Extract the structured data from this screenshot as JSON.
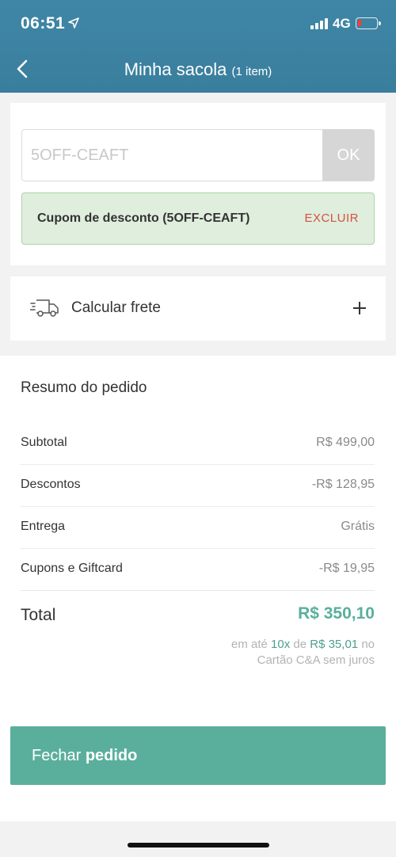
{
  "status_bar": {
    "time": "06:51",
    "network": "4G"
  },
  "nav": {
    "title": "Minha sacola",
    "item_count": "(1 item)"
  },
  "coupon": {
    "input_value": "5OFF-CEAFT",
    "ok_label": "OK",
    "applied_text": "Cupom de desconto (5OFF-CEAFT)",
    "remove_label": "EXCLUIR"
  },
  "shipping": {
    "label": "Calcular frete"
  },
  "summary": {
    "title": "Resumo do pedido",
    "rows": [
      {
        "label": "Subtotal",
        "value": "R$ 499,00"
      },
      {
        "label": "Descontos",
        "value": "-R$ 128,95"
      },
      {
        "label": "Entrega",
        "value": "Grátis"
      },
      {
        "label": "Cupons e Giftcard",
        "value": "-R$ 19,95"
      }
    ],
    "total_label": "Total",
    "total_value": "R$ 350,10",
    "installments": {
      "prefix": "em até",
      "count": "10x",
      "mid": "de",
      "amount": "R$ 35,01",
      "suffix": "no",
      "line2": "Cartão C&A sem juros"
    }
  },
  "checkout": {
    "label_regular": "Fechar",
    "label_bold": "pedido"
  },
  "colors": {
    "header": "#3f86a6",
    "accent": "#5aaf9c",
    "coupon_bg": "#dfeedd",
    "remove": "#d4513f"
  }
}
